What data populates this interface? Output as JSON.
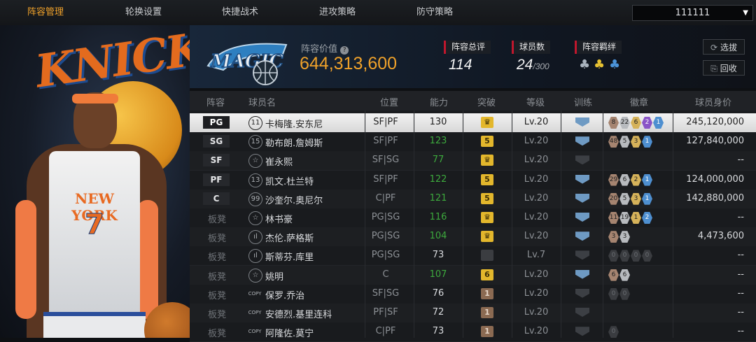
{
  "nav": {
    "tabs": [
      "阵容管理",
      "轮换设置",
      "快捷战术",
      "进攻策略",
      "防守策略"
    ],
    "active_index": 0,
    "account_dropdown": "111111"
  },
  "portrait": {
    "team_word": "KNICKS",
    "jersey_text": "NEW YORK",
    "jersey_number": "7"
  },
  "header": {
    "team_logo_text": "MAGIC",
    "lineup_value_label": "阵容价值",
    "lineup_value": "644,313,600",
    "overall_label": "阵容总评",
    "overall_value": "114",
    "player_count_label": "球员数",
    "player_count": "24",
    "player_count_max": "/300",
    "bond_label": "阵容羁绊",
    "btn_select": "选拔",
    "btn_recycle": "回收"
  },
  "table": {
    "headers": [
      "阵容",
      "球员名",
      "位置",
      "能力",
      "突破",
      "等级",
      "训练",
      "徽章",
      "球员身价"
    ],
    "rows": [
      {
        "slot": "PG",
        "badge_slot": true,
        "idx": "11",
        "name": "卡梅隆.安东尼",
        "pos": "SF|PF",
        "ability": "130",
        "green": false,
        "brk": "crown",
        "level": "Lv.20",
        "train": true,
        "badges": [
          [
            "br",
            "8"
          ],
          [
            "sv",
            "22"
          ],
          [
            "gd",
            "6"
          ],
          [
            "pp",
            "2"
          ],
          [
            "bl",
            "1"
          ]
        ],
        "value": "245,120,000"
      },
      {
        "slot": "SG",
        "badge_slot": true,
        "idx": "15",
        "name": "勒布朗.詹姆斯",
        "pos": "SF|PF",
        "ability": "123",
        "green": true,
        "brk": "5",
        "level": "Lv.20",
        "train": true,
        "badges": [
          [
            "br",
            "48"
          ],
          [
            "sv",
            "5"
          ],
          [
            "gd",
            "3"
          ],
          [
            "bl",
            "1"
          ]
        ],
        "value": "127,840,000"
      },
      {
        "slot": "SF",
        "badge_slot": true,
        "idx": "☆",
        "name": "崔永熙",
        "pos": "SF|SG",
        "ability": "77",
        "green": true,
        "brk": "crown",
        "level": "Lv.20",
        "train": false,
        "badges": [],
        "value": "--"
      },
      {
        "slot": "PF",
        "badge_slot": true,
        "idx": "13",
        "name": "凯文.杜兰特",
        "pos": "SF|PF",
        "ability": "122",
        "green": true,
        "brk": "5",
        "level": "Lv.20",
        "train": true,
        "badges": [
          [
            "br",
            "29"
          ],
          [
            "sv",
            "6"
          ],
          [
            "gd",
            "2"
          ],
          [
            "bl",
            "1"
          ]
        ],
        "value": "124,000,000"
      },
      {
        "slot": "C",
        "badge_slot": true,
        "idx": "99",
        "name": "沙奎尔.奥尼尔",
        "pos": "C|PF",
        "ability": "121",
        "green": true,
        "brk": "5",
        "level": "Lv.20",
        "train": true,
        "badges": [
          [
            "br",
            "20"
          ],
          [
            "sv",
            "5"
          ],
          [
            "gd",
            "3"
          ],
          [
            "bl",
            "1"
          ]
        ],
        "value": "142,880,000"
      },
      {
        "slot": "板凳",
        "badge_slot": false,
        "idx": "☆",
        "name": "林书豪",
        "pos": "PG|SG",
        "ability": "116",
        "green": true,
        "brk": "crown",
        "level": "Lv.20",
        "train": true,
        "badges": [
          [
            "br",
            "11"
          ],
          [
            "sv",
            "19"
          ],
          [
            "gd",
            "1"
          ],
          [
            "bl",
            "2"
          ]
        ],
        "value": "--"
      },
      {
        "slot": "板凳",
        "badge_slot": false,
        "idx": "ıl",
        "name": "杰伦.萨格斯",
        "pos": "PG|SG",
        "ability": "104",
        "green": true,
        "brk": "crown",
        "level": "Lv.20",
        "train": true,
        "badges": [
          [
            "br",
            "3"
          ],
          [
            "sv",
            "3"
          ]
        ],
        "value": "4,473,600"
      },
      {
        "slot": "板凳",
        "badge_slot": false,
        "idx": "ıl",
        "name": "斯蒂芬.库里",
        "pos": "PG|SG",
        "ability": "73",
        "green": false,
        "brk": "grey",
        "level": "Lv.7",
        "train": false,
        "badges": [
          [
            "dk",
            "0"
          ],
          [
            "dk",
            "0"
          ],
          [
            "dk",
            "0"
          ],
          [
            "dk",
            "0"
          ]
        ],
        "value": "--"
      },
      {
        "slot": "板凳",
        "badge_slot": false,
        "idx": "☆",
        "name": "姚明",
        "pos": "C",
        "ability": "107",
        "green": true,
        "brk": "6",
        "level": "Lv.20",
        "train": true,
        "badges": [
          [
            "br",
            "6"
          ],
          [
            "sv",
            "6"
          ]
        ],
        "value": "--"
      },
      {
        "slot": "板凳",
        "badge_slot": false,
        "idx": "COPY",
        "name": "保罗.乔治",
        "pos": "SF|SG",
        "ability": "76",
        "green": false,
        "brk": "1",
        "level": "Lv.20",
        "train": false,
        "badges": [
          [
            "dk",
            "0"
          ],
          [
            "dk",
            "0"
          ]
        ],
        "value": "--"
      },
      {
        "slot": "板凳",
        "badge_slot": false,
        "idx": "COPY",
        "name": "安德烈.基里连科",
        "pos": "PF|SF",
        "ability": "72",
        "green": false,
        "brk": "1",
        "level": "Lv.20",
        "train": false,
        "badges": [],
        "value": "--"
      },
      {
        "slot": "板凳",
        "badge_slot": false,
        "idx": "COPY",
        "name": "阿隆佐.莫宁",
        "pos": "C|PF",
        "ability": "73",
        "green": false,
        "brk": "1",
        "level": "Lv.20",
        "train": false,
        "badges": [
          [
            "dk",
            "0"
          ]
        ],
        "value": "--"
      }
    ]
  },
  "colors": {
    "accent": "#f0a22a",
    "green_ability": "#3daa3d",
    "red_marker": "#c0172d"
  }
}
